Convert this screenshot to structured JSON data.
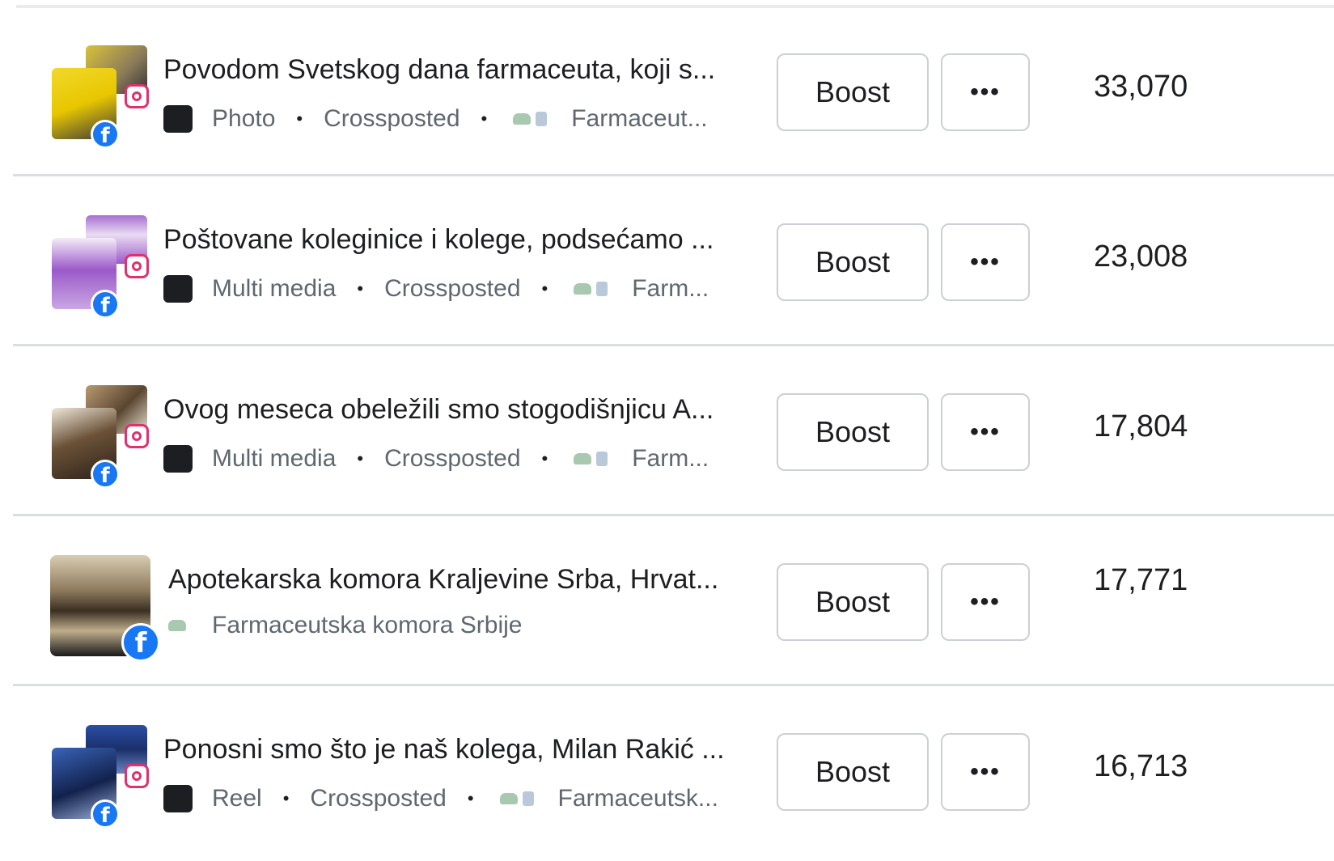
{
  "colors": {
    "divider": "#dadde1",
    "facebook": "#1877f2",
    "instagram": "#e1306c",
    "text": "#1c1e21",
    "meta_text": "#606770"
  },
  "posts": [
    {
      "title": "Povodom Svetskog dana farmaceuta, koji s...",
      "type_icon": "photo-icon",
      "type": "Photo",
      "crossposted": "Crossposted",
      "page": "Farmaceut...",
      "boost_label": "Boost",
      "more_label": "•••",
      "metric": "33,070",
      "platforms": [
        "instagram",
        "facebook"
      ]
    },
    {
      "title": "Poštovane koleginice i kolege, podsećamo ...",
      "type_icon": "multi-media-icon",
      "type": "Multi media",
      "crossposted": "Crossposted",
      "page": "Farm...",
      "boost_label": "Boost",
      "more_label": "•••",
      "metric": "23,008",
      "platforms": [
        "instagram",
        "facebook"
      ]
    },
    {
      "title": "Ovog meseca obeležili smo stogodišnjicu A...",
      "type_icon": "multi-media-icon",
      "type": "Multi media",
      "crossposted": "Crossposted",
      "page": "Farm...",
      "boost_label": "Boost",
      "more_label": "•••",
      "metric": "17,804",
      "platforms": [
        "instagram",
        "facebook"
      ]
    },
    {
      "title": "Apotekarska komora Kraljevine Srba, Hrvat...",
      "page": "Farmaceutska komora Srbije",
      "boost_label": "Boost",
      "more_label": "•••",
      "metric": "17,771",
      "platforms": [
        "facebook"
      ]
    },
    {
      "title": "Ponosni smo što je naš kolega, Milan Rakić ...",
      "type_icon": "reel-icon",
      "type": "Reel",
      "crossposted": "Crossposted",
      "page": "Farmaceutsk...",
      "boost_label": "Boost",
      "more_label": "•••",
      "metric": "16,713",
      "platforms": [
        "instagram",
        "facebook"
      ]
    }
  ],
  "separator": "•"
}
